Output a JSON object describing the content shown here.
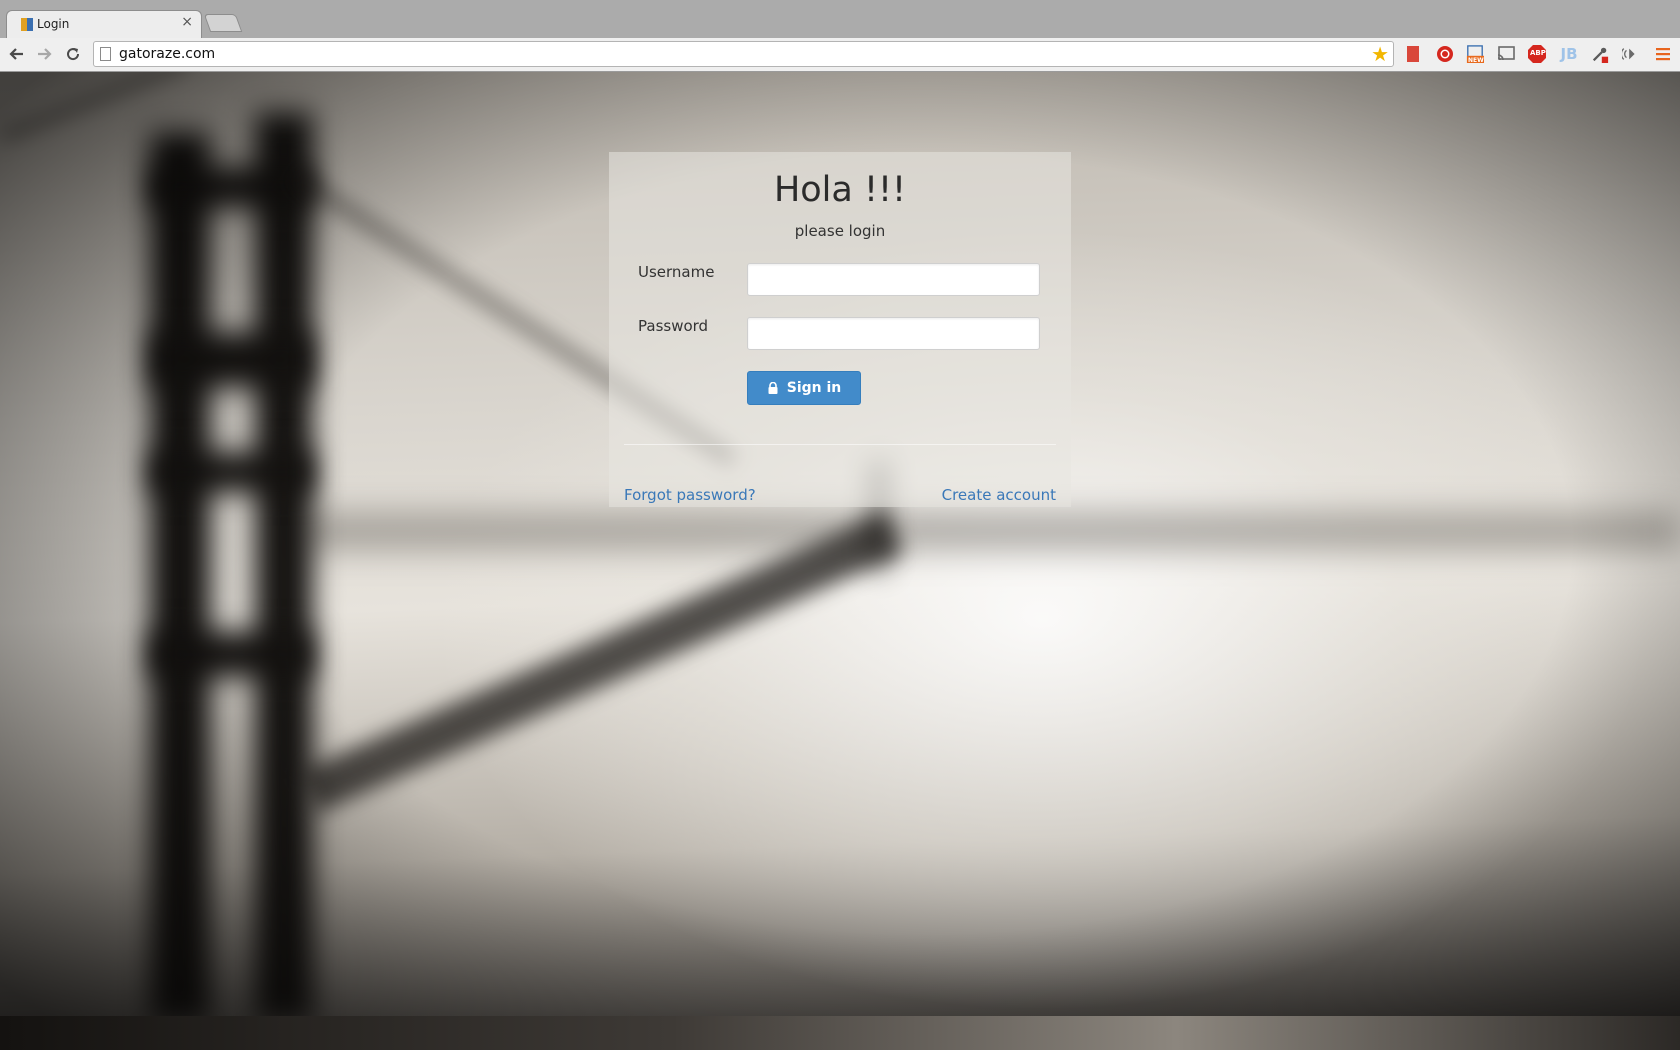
{
  "browser": {
    "tab_title": "Login",
    "tab_close": "×",
    "url": "gatoraze.com",
    "extensions": [
      "bookmark-ext",
      "record-ext",
      "new-ext",
      "cast-ext",
      "adblock-ext",
      "jb-ext",
      "eyedropper-ext",
      "sound-ext",
      "menu-ext"
    ],
    "extension_labels": {
      "adblock": "ABP",
      "jb": "JB",
      "new": "NEW"
    }
  },
  "login": {
    "title": "Hola !!!",
    "subtitle": "please login",
    "username_label": "Username",
    "username_value": "",
    "password_label": "Password",
    "password_value": "",
    "signin_label": "Sign in",
    "forgot_link": "Forgot password?",
    "create_link": "Create account"
  },
  "colors": {
    "primary_button": "#428bca",
    "link": "#3a78b8"
  }
}
